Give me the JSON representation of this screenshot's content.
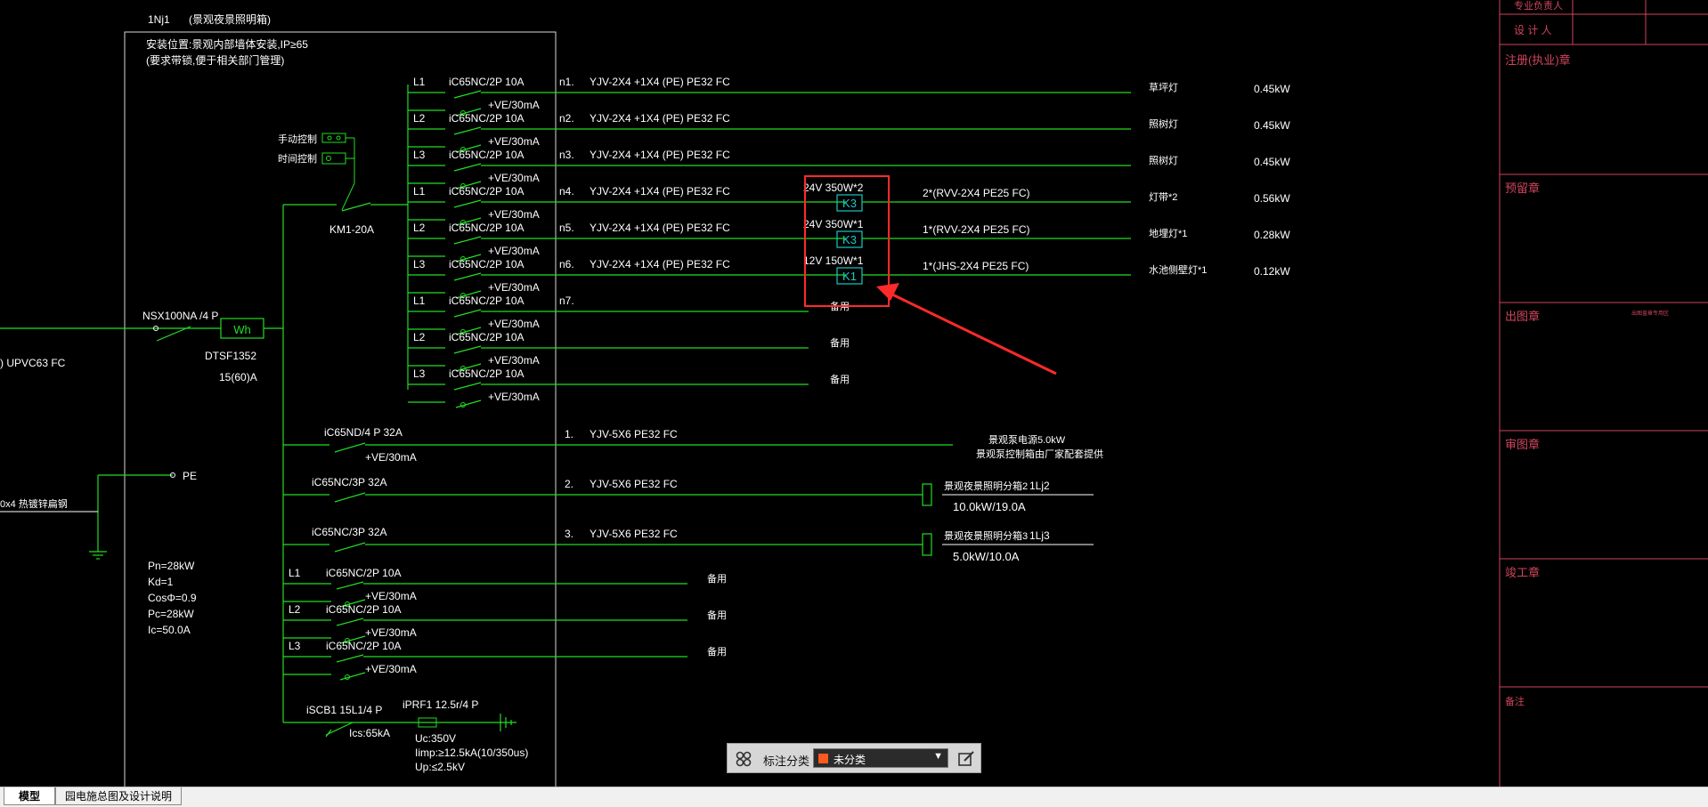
{
  "box": {
    "tag": "1Nj1",
    "name": "(景观夜景照明箱)",
    "install": "安装位置:景观内部墙体安装,IP≥65",
    "install2": "(要求带锁,便于相关部门管理)"
  },
  "incoming": {
    "conduit": ") UPVC63 FC",
    "breaker": "NSX100NA /4 P",
    "meter_symbol": "Wh",
    "meter_model": "DTSF1352",
    "meter_rating": "15(60)A",
    "pe": "PE",
    "earth_label": "0x4 热镀锌扁钢"
  },
  "controls": {
    "manual": "手动控制",
    "timer": "时间控制",
    "contactor": "KM1-20A"
  },
  "circuits": [
    {
      "phase": "L1",
      "breaker": "iC65NC/2P 10A",
      "rcd": "+VE/30mA",
      "num": "n1.",
      "cable": "YJV-2X4 +1X4 (PE) PE32 FC",
      "load": "草坪灯",
      "power": "0.45kW"
    },
    {
      "phase": "L2",
      "breaker": "iC65NC/2P 10A",
      "rcd": "+VE/30mA",
      "num": "n2.",
      "cable": "YJV-2X4 +1X4 (PE) PE32 FC",
      "load": "照树灯",
      "power": "0.45kW"
    },
    {
      "phase": "L3",
      "breaker": "iC65NC/2P 10A",
      "rcd": "+VE/30mA",
      "num": "n3.",
      "cable": "YJV-2X4 +1X4 (PE) PE32 FC",
      "load": "照树灯",
      "power": "0.45kW"
    },
    {
      "phase": "L1",
      "breaker": "iC65NC/2P 10A",
      "rcd": "+VE/30mA",
      "num": "n4.",
      "cable": "YJV-2X4 +1X4 (PE) PE32 FC",
      "transformer": "24V 350W*2",
      "tbox": "K3",
      "branch": "2*(RVV-2X4  PE25 FC)",
      "load": "灯带*2",
      "power": "0.56kW"
    },
    {
      "phase": "L2",
      "breaker": "iC65NC/2P 10A",
      "rcd": "+VE/30mA",
      "num": "n5.",
      "cable": "YJV-2X4 +1X4 (PE) PE32 FC",
      "transformer": "24V 350W*1",
      "tbox": "K3",
      "branch": "1*(RVV-2X4  PE25 FC)",
      "load": "地埋灯*1",
      "power": "0.28kW"
    },
    {
      "phase": "L3",
      "breaker": "iC65NC/2P 10A",
      "rcd": "+VE/30mA",
      "num": "n6.",
      "cable": "YJV-2X4 +1X4 (PE) PE32 FC",
      "transformer": "12V 150W*1",
      "tbox": "K1",
      "branch": "1*(JHS-2X4  PE25 FC)",
      "load": "水池侧壁灯*1",
      "power": "0.12kW"
    },
    {
      "phase": "L1",
      "breaker": "iC65NC/2P 10A",
      "rcd": "+VE/30mA",
      "num": "n7.",
      "load": "备用"
    },
    {
      "phase": "L2",
      "breaker": "iC65NC/2P 10A",
      "rcd": "+VE/30mA",
      "load": "备用"
    },
    {
      "phase": "L3",
      "breaker": "iC65NC/2P 10A",
      "rcd": "+VE/30mA",
      "load": "备用"
    }
  ],
  "feeders": [
    {
      "breaker": "iC65ND/4 P 32A",
      "rcd": "+VE/30mA",
      "num": "1.",
      "cable": "YJV-5X6  PE32 FC",
      "load": "景观泵电源5.0kW",
      "load2": "景观泵控制箱由厂家配套提供"
    },
    {
      "breaker": "iC65NC/3P 32A",
      "num": "2.",
      "cable": "YJV-5X6  PE32 FC",
      "load": "景观夜景照明分箱2",
      "tag": "1Lj2",
      "rating": "10.0kW/19.0A"
    },
    {
      "breaker": "iC65NC/3P 32A",
      "num": "3.",
      "cable": "YJV-5X6  PE32 FC",
      "load": "景观夜景照明分箱3",
      "tag": "1Lj3",
      "rating": "5.0kW/10.0A"
    }
  ],
  "spares": [
    {
      "phase": "L1",
      "breaker": "iC65NC/2P 10A",
      "rcd": "+VE/30mA",
      "load": "备用"
    },
    {
      "phase": "L2",
      "breaker": "iC65NC/2P 10A",
      "rcd": "+VE/30mA",
      "load": "备用"
    },
    {
      "phase": "L3",
      "breaker": "iC65NC/2P 10A",
      "rcd": "+VE/30mA",
      "load": "备用"
    }
  ],
  "params": [
    "Pn=28kW",
    "Kd=1",
    "CosΦ=0.9",
    "Pc=28kW",
    "Ic=50.0A"
  ],
  "spd": {
    "iscb": "iSCB1 15L1/4 P",
    "ics": "Ics:65kA",
    "iprf": "iPRF1 12.5r/4 P",
    "uc": "Uc:350V",
    "iimp": "Iimp:≥12.5kA(10/350us)",
    "up": "Up:≤2.5kV"
  },
  "titleblock": {
    "row1": "专业负责人",
    "row2": "设 计 人",
    "sections": [
      "注册(执业)章",
      "预留章",
      "出图章",
      "审图章",
      "竣工章",
      "备注"
    ],
    "tiny": "出图盖章专用区"
  },
  "toolbar": {
    "label": "标注分类",
    "value": "未分类"
  },
  "tabs": {
    "model": "模型",
    "layout": "园电施总图及设计说明"
  },
  "colors": {
    "wire": "#22dd22",
    "text": "#ffffff",
    "highlight": "#ff2a2a",
    "titleblock": "#d0455c",
    "frame": "#d8d8d8",
    "tbox": "#1cc6c6"
  }
}
